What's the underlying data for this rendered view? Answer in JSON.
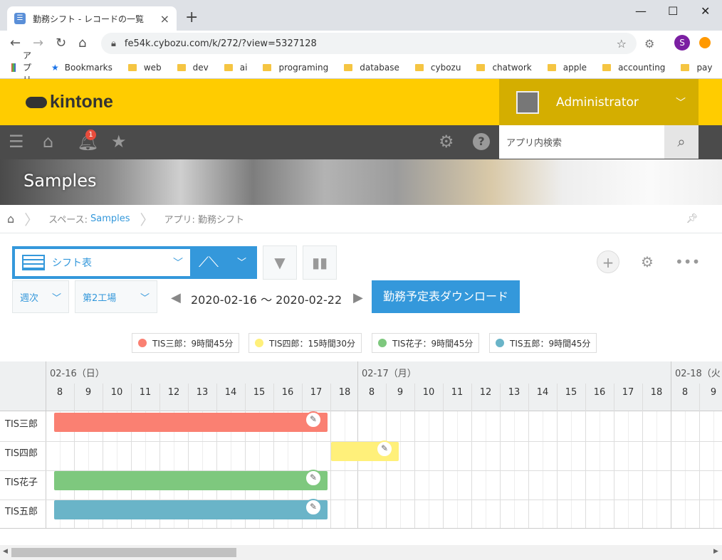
{
  "browser": {
    "tab_title": "勤務シフト - レコードの一覧",
    "url": "fe54k.cybozu.com/k/272/?view=5327128",
    "profile_initial": "S",
    "bookmarks": [
      "アプリ",
      "Bookmarks",
      "web",
      "dev",
      "ai",
      "programing",
      "database",
      "cybozu",
      "chatwork",
      "apple",
      "accounting",
      "pay"
    ],
    "more": "»"
  },
  "header": {
    "logo": "kintone",
    "user": "Administrator",
    "notification_count": "1",
    "search_placeholder": "アプリ内検索"
  },
  "banner": {
    "title": "Samples"
  },
  "breadcrumb": {
    "space_prefix": "スペース:",
    "space": "Samples",
    "app": "アプリ: 勤務シフト"
  },
  "view": {
    "selected": "シフト表",
    "period": "週次",
    "location": "第2工場",
    "range": "2020-02-16 〜 2020-02-22",
    "download": "勤務予定表ダウンロード"
  },
  "legend": [
    {
      "label": "TIS三郎：9時間45分",
      "color": "#fa8072"
    },
    {
      "label": "TIS四郎：15時間30分",
      "color": "#fff07a"
    },
    {
      "label": "TIS花子：9時間45分",
      "color": "#7ec87e"
    },
    {
      "label": "TIS五郎：9時間45分",
      "color": "#6ab4c8"
    }
  ],
  "calendar": {
    "days": [
      "02-16（日）",
      "02-17（月）",
      "02-18（火"
    ],
    "hours_day1": [
      "8",
      "9",
      "10",
      "11",
      "12",
      "13",
      "14",
      "15",
      "16",
      "17",
      "18"
    ],
    "hours_day2": [
      "8",
      "9",
      "10",
      "11",
      "12",
      "13",
      "14",
      "15",
      "16",
      "17",
      "18"
    ],
    "hours_day3": [
      "8",
      "9"
    ],
    "rows": [
      "TIS三郎",
      "TIS四郎",
      "TIS花子",
      "TIS五郎"
    ]
  }
}
